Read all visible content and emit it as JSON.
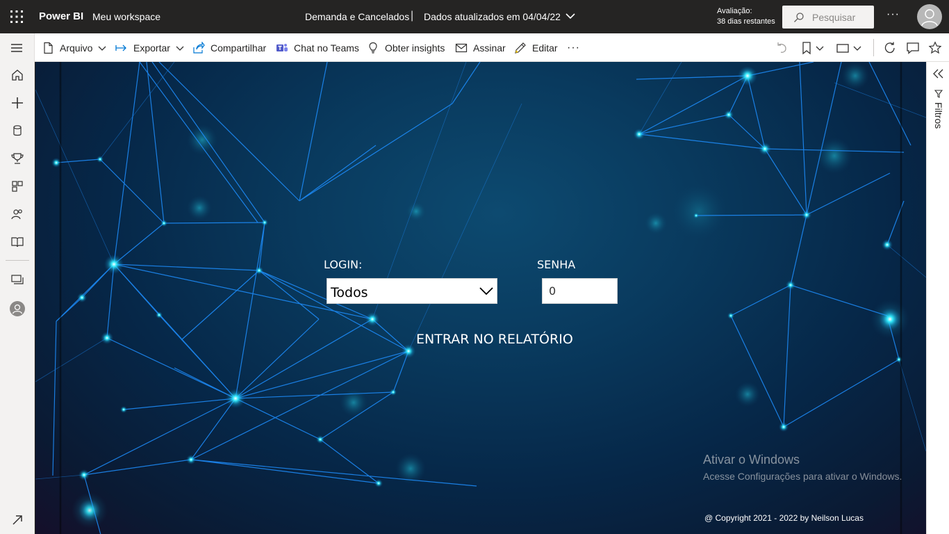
{
  "topbar": {
    "brand": "Power BI",
    "workspace": "Meu workspace",
    "report_title": "Demanda e Cancelados",
    "separator": "|",
    "updated": "Dados atualizados em 04/04/22",
    "trial_line1": "Avaliação:",
    "trial_line2": "38 dias restantes",
    "search_placeholder": "Pesquisar",
    "more": "···"
  },
  "leftrail": {
    "items": [
      "home-icon",
      "create-icon",
      "datahub-icon",
      "goals-icon",
      "apps-icon",
      "shared-icon",
      "learn-icon",
      "workspaces-icon",
      "my-workspace-icon",
      "expand-icon"
    ]
  },
  "actionbar": {
    "arquivo": "Arquivo",
    "exportar": "Exportar",
    "compartilhar": "Compartilhar",
    "teams": "Chat no Teams",
    "insights": "Obter insights",
    "assinar": "Assinar",
    "editar": "Editar",
    "more": "···"
  },
  "report": {
    "login_label": "LOGIN:",
    "login_value": "Todos",
    "senha_label": "SENHA",
    "senha_value": "0",
    "enter_button": "ENTRAR NO RELATÓRIO",
    "watermark_title": "Ativar o Windows",
    "watermark_sub": "Acesse Configurações para ativar o Windows.",
    "copyright": "@ Copyright 2021 - 2022 by Neilson Lucas"
  },
  "filters": {
    "label": "Filtros"
  },
  "colors": {
    "topbar_bg": "#252423",
    "rail_bg": "#f3f2f1",
    "canvas_bg": "#093a5e",
    "node_glow": "#19e0ff",
    "line_color": "#1e8fff"
  }
}
